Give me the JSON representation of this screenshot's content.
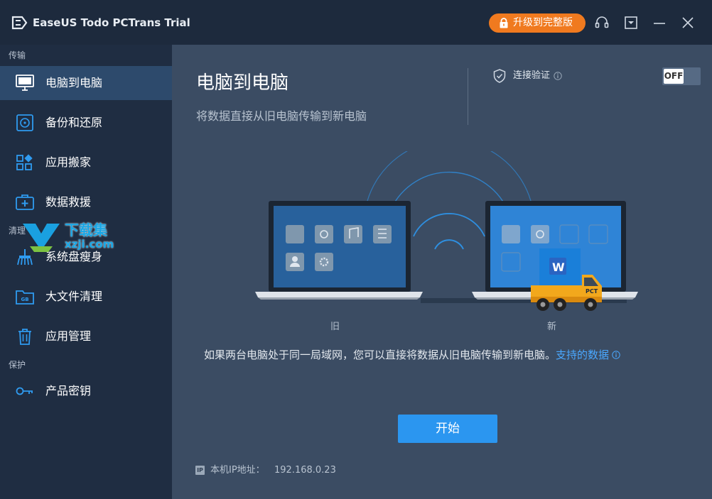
{
  "window": {
    "title": "EaseUS Todo PCTrans Trial",
    "upgrade_label": "升级到完整版"
  },
  "sidebar": {
    "sections": {
      "transfer": "传输",
      "clean": "清理",
      "protect": "保护"
    },
    "items": [
      {
        "label": "电脑到电脑",
        "icon": "monitor-icon",
        "active": true
      },
      {
        "label": "备份和还原",
        "icon": "disk-icon",
        "active": false
      },
      {
        "label": "应用搬家",
        "icon": "apps-icon",
        "active": false
      },
      {
        "label": "数据救援",
        "icon": "rescue-kit-icon",
        "active": false
      },
      {
        "label": "系统盘瘦身",
        "icon": "broom-icon",
        "active": false
      },
      {
        "label": "大文件清理",
        "icon": "folder-gb-icon",
        "active": false
      },
      {
        "label": "应用管理",
        "icon": "trash-icon",
        "active": false
      },
      {
        "label": "产品密钥",
        "icon": "key-icon",
        "active": false
      }
    ]
  },
  "main": {
    "title": "电脑到电脑",
    "subtitle": "将数据直接从旧电脑传输到新电脑",
    "verify_label": "连接验证",
    "toggle_label": "OFF",
    "old_label": "旧",
    "new_label": "新",
    "hint_text": "如果两台电脑处于同一局域网，您可以直接将数据从旧电脑传输到新电脑。",
    "hint_link": "支持的数据",
    "start_label": "开始",
    "ip_badge": "IP",
    "ip_label": "本机IP地址：",
    "ip_value": "192.168.0.23",
    "truck_label": "PCT"
  },
  "watermark": {
    "text": "下载集",
    "url": "xzji.com"
  },
  "colors": {
    "accent": "#2b96f0",
    "upgrade": "#f07a1f",
    "sidebar": "#1f2d42",
    "content": "#3b4c63",
    "link": "#4aa8ff"
  }
}
